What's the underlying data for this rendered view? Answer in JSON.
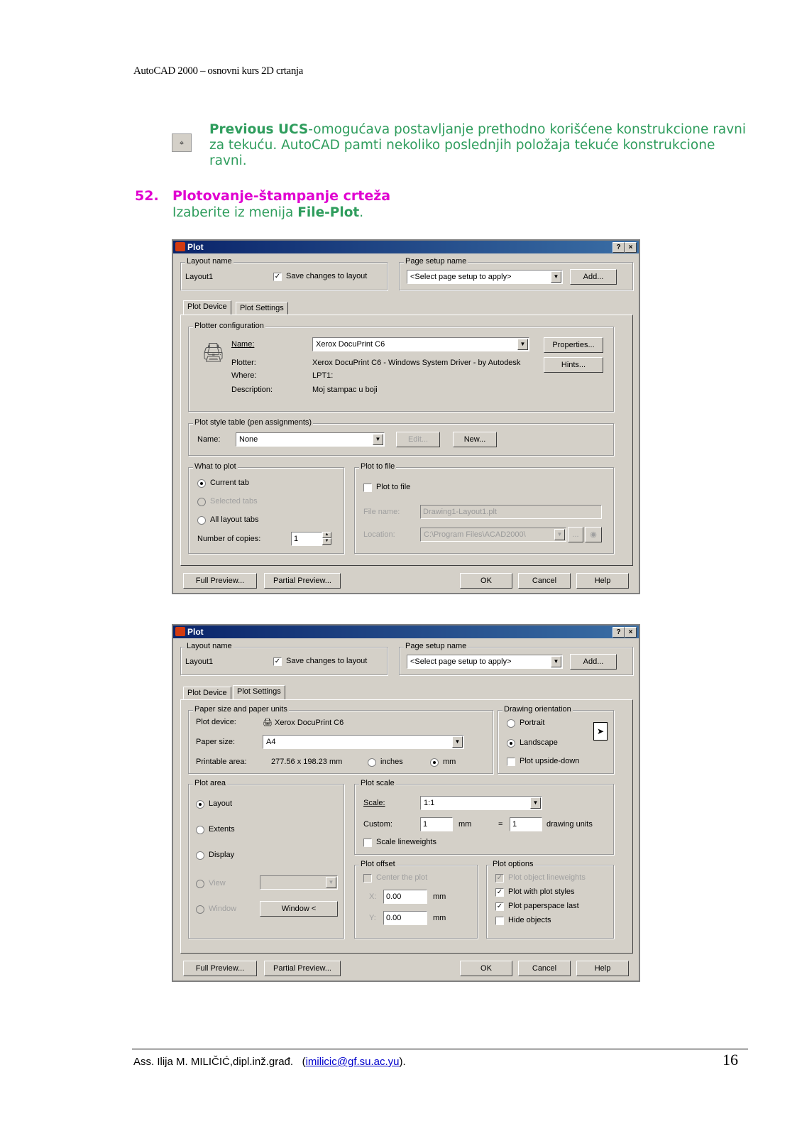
{
  "header": {
    "text": "AutoCAD 2000 – osnovni kurs 2D crtanja"
  },
  "ucs": {
    "title": "Previous UCS",
    "text": "-omogućava postavljanje prethodno korišćene konstrukcione ravni za tekuću. AutoCAD pamti nekoliko poslednjih položaja tekuće konstrukcione ravni."
  },
  "section": {
    "number": "52.",
    "title": "Plotovanje-štampanje crteža",
    "intro": "Izaberite iz menija ",
    "menu": "File-Plot",
    "period": "."
  },
  "dialog_common": {
    "title": "Plot",
    "help_btn": "?",
    "close_btn": "×",
    "layout_name_group": "Layout name",
    "layout_name": "Layout1",
    "save_changes": "Save changes to layout",
    "page_setup_group": "Page setup name",
    "page_setup_value": "<Select page setup to apply>",
    "add_btn": "Add...",
    "tab_device": "Plot Device",
    "tab_settings": "Plot Settings",
    "full_preview": "Full Preview...",
    "partial_preview": "Partial Preview...",
    "ok": "OK",
    "cancel": "Cancel",
    "help": "Help",
    "arrow": "▼"
  },
  "device": {
    "plotter_group": "Plotter configuration",
    "name_label": "Name:",
    "name_value": "Xerox DocuPrint C6",
    "plotter_label": "Plotter:",
    "plotter_value": "Xerox DocuPrint C6 - Windows System Driver - by Autodesk",
    "where_label": "Where:",
    "where_value": "LPT1:",
    "desc_label": "Description:",
    "desc_value": "Moj stampac u boji",
    "properties_btn": "Properties...",
    "hints_btn": "Hints...",
    "style_group": "Plot style table (pen assignments)",
    "style_name_label": "Name:",
    "style_value": "None",
    "edit_btn": "Edit...",
    "new_btn": "New...",
    "what_group": "What to plot",
    "current_tab": "Current tab",
    "selected_tabs": "Selected tabs",
    "all_layout_tabs": "All layout tabs",
    "copies_label": "Number of copies:",
    "copies_value": "1",
    "file_group": "Plot to file",
    "plot_to_file": "Plot to file",
    "file_name_label": "File name:",
    "file_name_value": "Drawing1-Layout1.plt",
    "location_label": "Location:",
    "location_value": "C:\\Program Files\\ACAD2000\\",
    "browse_btn": "..."
  },
  "settings": {
    "paper_group": "Paper size and paper units",
    "plot_device_label": "Plot device:",
    "plot_device_value": "Xerox DocuPrint C6",
    "paper_size_label": "Paper size:",
    "paper_size_value": "A4",
    "printable_label": "Printable area:",
    "printable_value": "277.56 x 198.23 mm",
    "inches": "inches",
    "mm": "mm",
    "orient_group": "Drawing orientation",
    "portrait": "Portrait",
    "landscape": "Landscape",
    "upside_down": "Plot upside-down",
    "area_group": "Plot area",
    "layout": "Layout",
    "extents": "Extents",
    "display": "Display",
    "view": "View",
    "window": "Window",
    "window_btn": "Window <",
    "scale_group": "Plot scale",
    "scale_label": "Scale:",
    "scale_value": "1:1",
    "custom_label": "Custom:",
    "custom_value1": "1",
    "custom_unit1": "mm",
    "equals": "=",
    "custom_value2": "1",
    "custom_unit2": "drawing units",
    "scale_lw": "Scale lineweights",
    "offset_group": "Plot offset",
    "center": "Center the plot",
    "x_label": "X:",
    "x_value": "0.00",
    "y_label": "Y:",
    "y_value": "0.00",
    "offset_unit": "mm",
    "options_group": "Plot options",
    "opt_lineweights": "Plot object lineweights",
    "opt_styles": "Plot with plot styles",
    "opt_paperspace": "Plot paperspace last",
    "opt_hide": "Hide objects"
  },
  "footer": {
    "author": "Ass. Ilija M. MILIČIĆ,dipl.inž.građ.",
    "open": "(",
    "email": "imilicic@gf.su.ac.yu",
    "close": ").",
    "page": "16"
  },
  "colors": {
    "green": "#2f9d5d",
    "magenta": "#e000d0",
    "titlebar": "#0a246a",
    "dialog_bg": "#d4d0c8"
  }
}
